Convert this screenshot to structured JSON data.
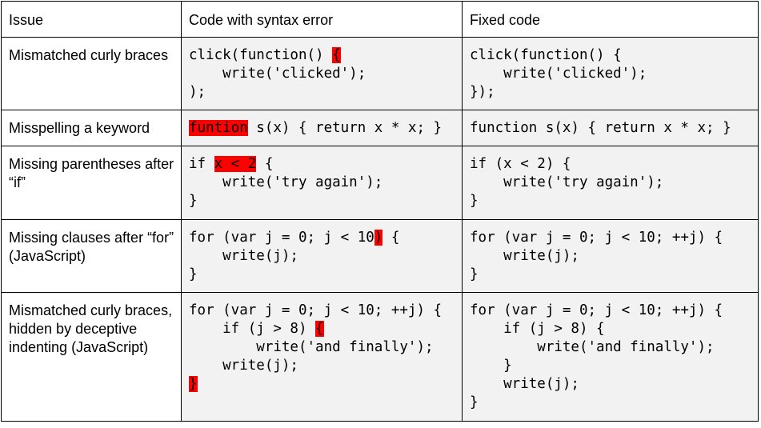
{
  "headers": [
    "Issue",
    "Code with syntax error",
    "Fixed code"
  ],
  "rows": [
    {
      "issue": "Mismatched curly braces",
      "bad": [
        [
          {
            "t": "click(function() "
          },
          {
            "t": "{",
            "hl": true
          }
        ],
        [
          {
            "t": "    write('clicked');"
          }
        ],
        [
          {
            "t": ");"
          }
        ]
      ],
      "fixed": [
        "click(function() {",
        "    write('clicked');",
        "});"
      ]
    },
    {
      "issue": "Misspelling a keyword",
      "bad": [
        [
          {
            "t": "funtion",
            "hl": true
          },
          {
            "t": " s(x) { return x * x; }"
          }
        ]
      ],
      "fixed": [
        "function s(x) { return x * x; }"
      ]
    },
    {
      "issue": "Missing parentheses after “if”",
      "bad": [
        [
          {
            "t": "if "
          },
          {
            "t": "x < 2",
            "hl": true
          },
          {
            "t": " {"
          }
        ],
        [
          {
            "t": "    write('try again');"
          }
        ],
        [
          {
            "t": "}"
          }
        ]
      ],
      "fixed": [
        "if (x < 2) {",
        "    write('try again');",
        "}"
      ]
    },
    {
      "issue": "Missing clauses after “for” (JavaScript)",
      "bad": [
        [
          {
            "t": "for (var j = 0; j < 10"
          },
          {
            "t": ")",
            "hl": true
          },
          {
            "t": " {"
          }
        ],
        [
          {
            "t": "    write(j);"
          }
        ],
        [
          {
            "t": "}"
          }
        ]
      ],
      "fixed": [
        "for (var j = 0; j < 10; ++j) {",
        "    write(j);",
        "}"
      ]
    },
    {
      "issue": "Mismatched curly braces, hidden by deceptive indenting (JavaScript)",
      "bad": [
        [
          {
            "t": "for (var j = 0; j < 10; ++j) {"
          }
        ],
        [
          {
            "t": "    if (j > 8) "
          },
          {
            "t": "{",
            "hl": true
          }
        ],
        [
          {
            "t": "        write('and finally');"
          }
        ],
        [
          {
            "t": "    write(j);"
          }
        ],
        [
          {
            "t": "}",
            "hl": true
          }
        ]
      ],
      "fixed": [
        "for (var j = 0; j < 10; ++j) {",
        "    if (j > 8) {",
        "        write('and finally');",
        "    }",
        "    write(j);",
        "}"
      ]
    }
  ],
  "colors": {
    "highlight": "#ff0000",
    "code_background": "#f2f2f2",
    "border": "#000000"
  }
}
